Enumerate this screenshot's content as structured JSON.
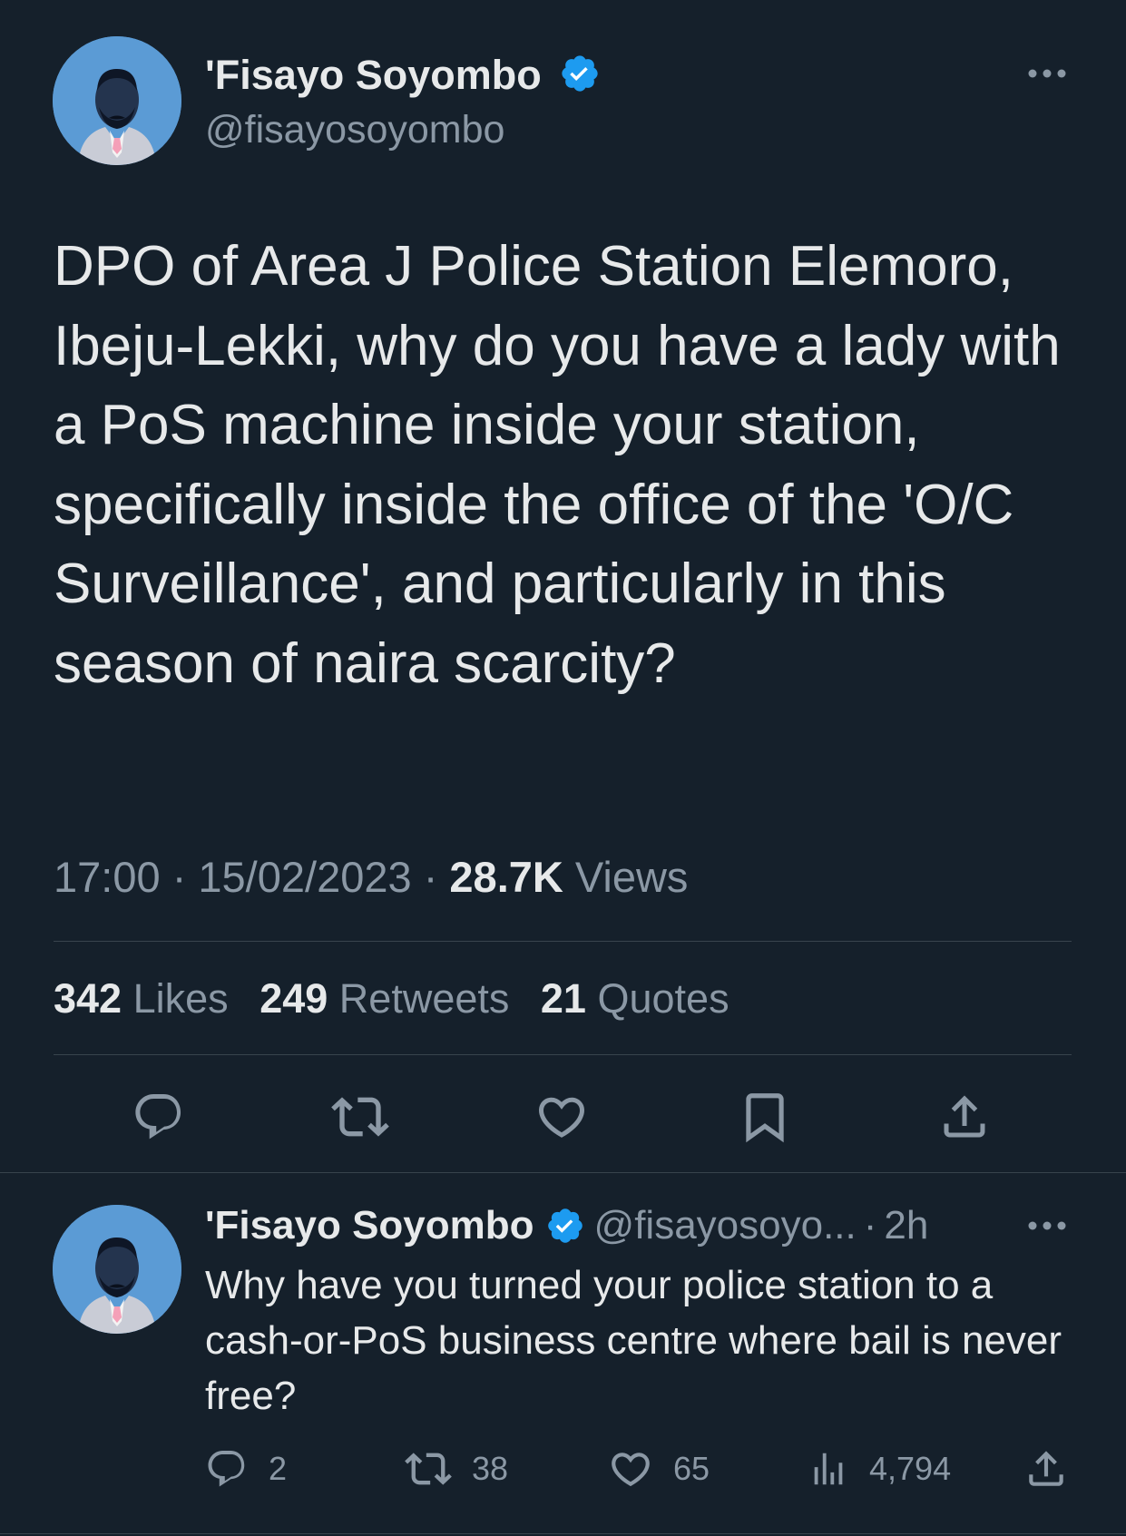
{
  "tweet": {
    "author_name": "'Fisayo Soyombo",
    "author_handle": "@fisayosoyombo",
    "text": "DPO of Area J Police Station Elemoro, Ibeju-Lekki, why do you have a lady with a PoS machine inside your station, specifically inside the office of the 'O/C Surveillance', and particularly in this season of naira scarcity?",
    "time": "17:00",
    "date": "15/02/2023",
    "views_count": "28.7K",
    "views_label": "Views",
    "likes_count": "342",
    "likes_label": "Likes",
    "retweets_count": "249",
    "retweets_label": "Retweets",
    "quotes_count": "21",
    "quotes_label": "Quotes",
    "separator": "·"
  },
  "actions": {
    "icons": [
      "reply-icon",
      "retweet-icon",
      "like-icon",
      "bookmark-icon",
      "share-icon"
    ]
  },
  "reply": {
    "author_name": "'Fisayo Soyombo",
    "author_handle": "@fisayosoyo...",
    "separator": "·",
    "age": "2h",
    "text": "Why have you turned your police station to a cash-or-PoS business centre where bail is never free?",
    "replies": "2",
    "retweets": "38",
    "likes": "65",
    "views": "4,794"
  },
  "colors": {
    "background": "#15202b",
    "text": "#e7e9ea",
    "secondary": "#8b98a5",
    "verified": "#1d9bf0",
    "divider": "#38444d",
    "avatar_bg": "#5b9bd5"
  }
}
